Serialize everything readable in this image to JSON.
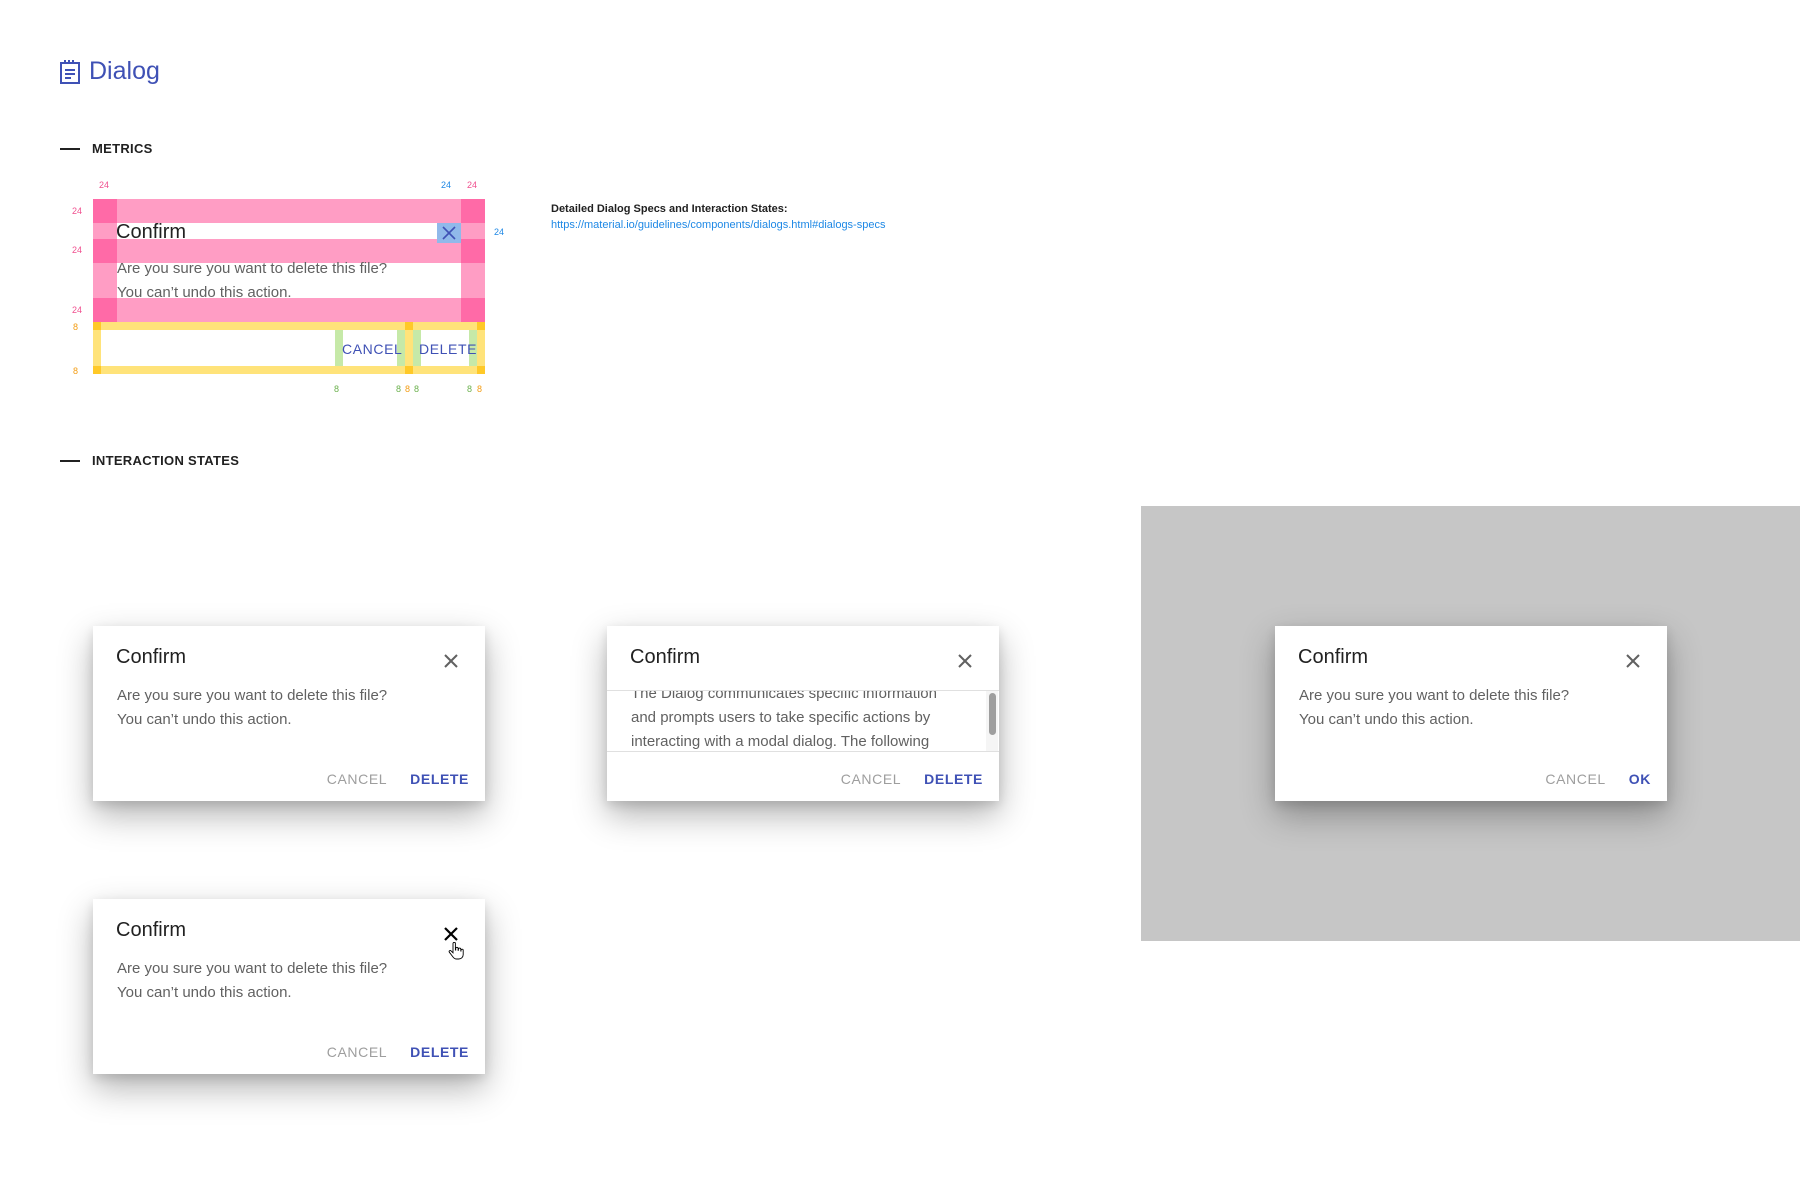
{
  "header": {
    "title": "Dialog",
    "icon": "document-icon"
  },
  "sections": {
    "metrics": "METRICS",
    "interaction_states": "INTERACTION STATES"
  },
  "spec": {
    "title": "Detailed Dialog Specs and Interaction States:",
    "link": "https://material.io/guidelines/components/dialogs.html#dialogs-specs"
  },
  "metrics": {
    "labels": {
      "m24": "24",
      "m8": "8"
    },
    "dialog": {
      "title": "Confirm",
      "body_line1": "Are you sure you want to delete this file?",
      "body_line2": "You can’t undo this action.",
      "cancel": "CANCEL",
      "confirm": "DELETE"
    }
  },
  "dialogs": {
    "default": {
      "title": "Confirm",
      "body_line1": "Are you sure you want to delete this file?",
      "body_line2": "You can’t undo this action.",
      "cancel": "CANCEL",
      "confirm": "DELETE"
    },
    "scrolling": {
      "title": "Confirm",
      "body_line1": "The Dialog communicates specific information",
      "body_line2": "and prompts users to take specific actions by",
      "body_line3": "interacting with a modal dialog. The following",
      "cancel": "CANCEL",
      "confirm": "DELETE"
    },
    "overlay": {
      "title": "Confirm",
      "body_line1": "Are you sure you want to delete this file?",
      "body_line2": "You can’t undo this action.",
      "cancel": "CANCEL",
      "confirm": "OK"
    },
    "hover": {
      "title": "Confirm",
      "body_line1": "Are you sure you want to delete this file?",
      "body_line2": "You can’t undo this action.",
      "cancel": "CANCEL",
      "confirm": "DELETE"
    }
  },
  "colors": {
    "accent": "#3f51b5",
    "link": "#1e88e5",
    "overlay": "#c6c6c6"
  }
}
